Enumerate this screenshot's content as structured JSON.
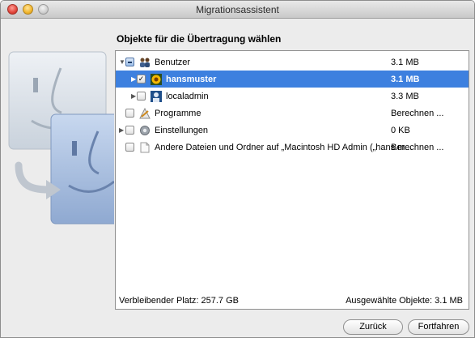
{
  "window": {
    "title": "Migrationsassistent"
  },
  "heading": "Objekte für die Übertragung wählen",
  "items": [
    {
      "label": "Benutzer",
      "size": "3.1 MB",
      "expanded": true,
      "check": "mixed",
      "icon": "users-group-icon"
    },
    {
      "label": "hansmuster",
      "size": "3.1 MB",
      "selected": true,
      "check": "checked",
      "icon": "user-sunflower-icon"
    },
    {
      "label": "localadmin",
      "size": "3.3 MB",
      "check": "unchecked",
      "icon": "user-admin-icon"
    },
    {
      "label": "Programme",
      "size": "Berechnen ...",
      "check": "unchecked",
      "icon": "applications-icon"
    },
    {
      "label": "Einstellungen",
      "size": "0 KB",
      "check": "unchecked",
      "icon": "gear-icon"
    },
    {
      "label": "Andere Dateien und Ordner auf „Macintosh HD Admin („hans.m...",
      "size": "Berechnen ...",
      "check": "unchecked",
      "icon": "document-icon"
    }
  ],
  "footer": {
    "remaining": "Verbleibender Platz: 257.7 GB",
    "selected": "Ausgewählte Objekte: 3.1 MB"
  },
  "buttons": {
    "back": "Zurück",
    "continue": "Fortfahren"
  },
  "colors": {
    "selection": "#3d80df",
    "window_bg": "#ececec"
  }
}
